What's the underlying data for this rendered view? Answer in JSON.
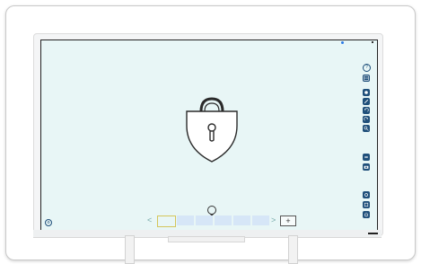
{
  "device": {
    "brand_label": "",
    "camera_indicator_color": "#2c7be5"
  },
  "screen": {
    "background": "#e8f6f6",
    "center_icon": "lock-shield-icon"
  },
  "toolbar": {
    "help_label": "?",
    "items": [
      {
        "icon": "grid-icon"
      },
      {
        "icon": "hand-icon"
      },
      {
        "icon": "pen-icon"
      },
      {
        "icon": "undo-icon"
      },
      {
        "icon": "redo-icon"
      },
      {
        "icon": "zoom-icon"
      },
      {
        "icon": "minimize-icon"
      },
      {
        "icon": "camera-icon"
      },
      {
        "icon": "settings-icon"
      },
      {
        "icon": "share-icon"
      },
      {
        "icon": "power-icon"
      }
    ]
  },
  "pager": {
    "prev": "<",
    "next": ">",
    "add": "+",
    "page_count": 6,
    "active_page": 1
  },
  "misc": {
    "chevron_icon": "chevron-down-icon",
    "left_settings_label": "⚙"
  }
}
